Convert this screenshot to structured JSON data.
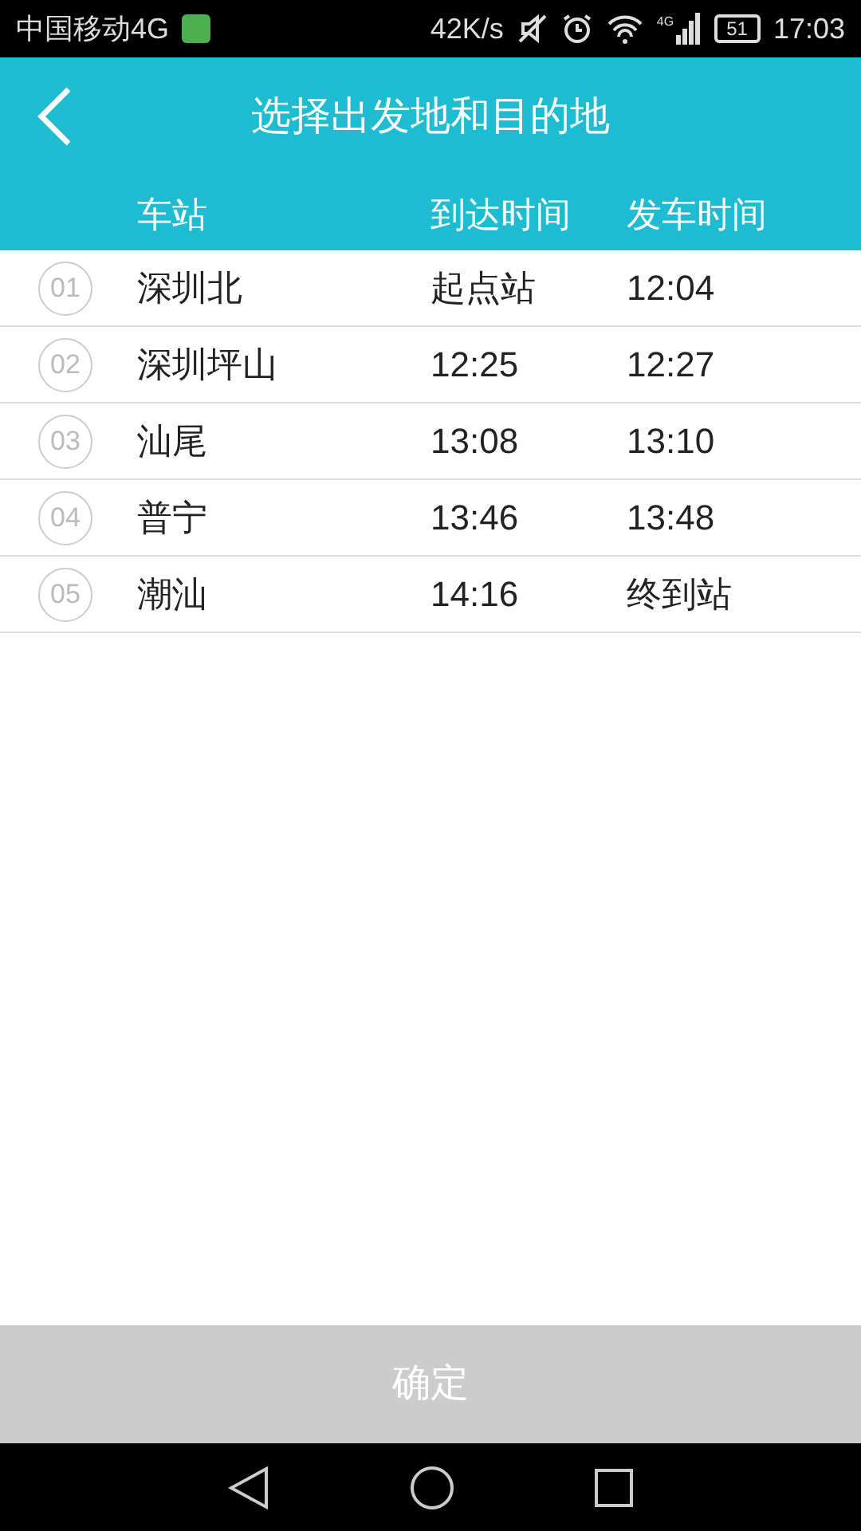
{
  "status_bar": {
    "carrier": "中国移动4G",
    "speed": "42K/s",
    "network": "4G",
    "battery": "51",
    "time": "17:03"
  },
  "header": {
    "title": "选择出发地和目的地"
  },
  "table": {
    "columns": [
      "车站",
      "到达时间",
      "发车时间"
    ],
    "rows": [
      {
        "number": "01",
        "station": "深圳北",
        "arrival": "起点站",
        "departure": "12:04"
      },
      {
        "number": "02",
        "station": "深圳坪山",
        "arrival": "12:25",
        "departure": "12:27"
      },
      {
        "number": "03",
        "station": "汕尾",
        "arrival": "13:08",
        "departure": "13:10"
      },
      {
        "number": "04",
        "station": "普宁",
        "arrival": "13:46",
        "departure": "13:48"
      },
      {
        "number": "05",
        "station": "潮汕",
        "arrival": "14:16",
        "departure": "终到站"
      }
    ]
  },
  "confirm_button": {
    "label": "确定",
    "disabled": true
  }
}
